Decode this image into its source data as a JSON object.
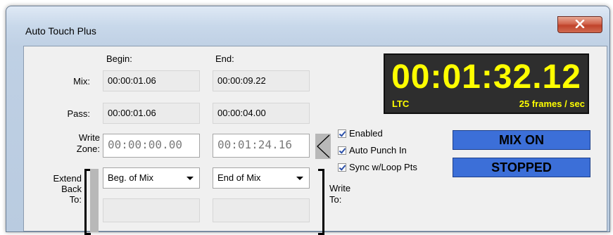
{
  "window": {
    "title": "Auto Touch Plus"
  },
  "headers": {
    "begin": "Begin:",
    "end": "End:"
  },
  "rows": {
    "mix": {
      "label": "Mix:",
      "begin": "00:00:01.06",
      "end": "00:00:09.22"
    },
    "pass": {
      "label": "Pass:",
      "begin": "00:00:01.06",
      "end": "00:00:04.00"
    },
    "write_zone": {
      "label_line1": "Write",
      "label_line2": "Zone:",
      "begin": "00:00:00.00",
      "end": "00:01:24.16"
    },
    "extend_back": {
      "label_line1": "Extend",
      "label_line2": "Back",
      "label_line3": "To:",
      "begin_option": "Beg. of Mix",
      "end_option": "End of Mix"
    }
  },
  "write_to": {
    "line1": "Write",
    "line2": "To:"
  },
  "timecode": {
    "value": "00:01:32.12",
    "source": "LTC",
    "rate": "25 frames / sec"
  },
  "checkboxes": [
    {
      "label": "Enabled",
      "checked": true
    },
    {
      "label": "Auto Punch In",
      "checked": true
    },
    {
      "label": "Sync w/Loop Pts",
      "checked": true
    }
  ],
  "status": {
    "mix": "MIX ON",
    "transport": "STOPPED"
  },
  "colors": {
    "timecode_text": "#ffff00",
    "timecode_bg": "#2e2e2e",
    "status_bg": "#3c6fd8",
    "close_button": "#c8503a"
  },
  "icons": {
    "close": "close-x-icon",
    "zone_arrow": "left-arrow-icon"
  }
}
